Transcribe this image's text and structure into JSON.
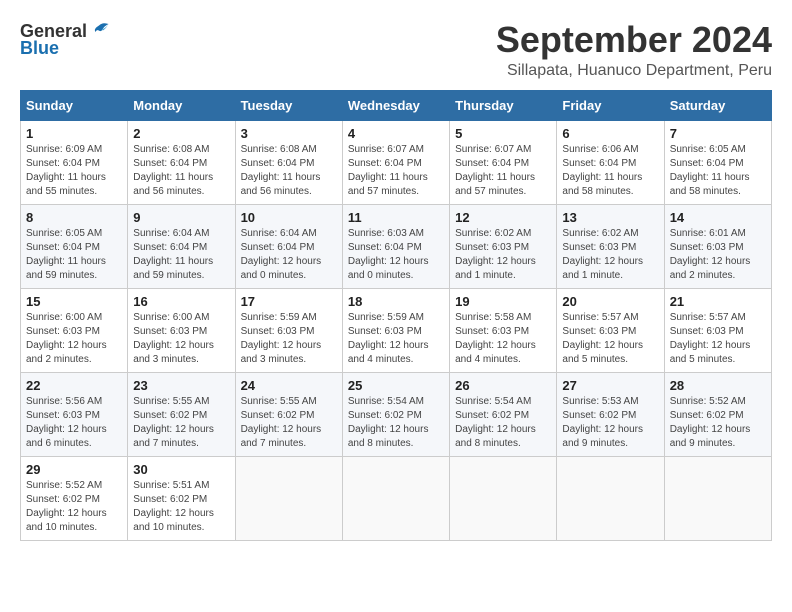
{
  "header": {
    "logo_general": "General",
    "logo_blue": "Blue",
    "month_title": "September 2024",
    "location": "Sillapata, Huanuco Department, Peru"
  },
  "weekdays": [
    "Sunday",
    "Monday",
    "Tuesday",
    "Wednesday",
    "Thursday",
    "Friday",
    "Saturday"
  ],
  "weeks": [
    [
      {
        "day": "1",
        "sunrise": "Sunrise: 6:09 AM",
        "sunset": "Sunset: 6:04 PM",
        "daylight": "Daylight: 11 hours and 55 minutes."
      },
      {
        "day": "2",
        "sunrise": "Sunrise: 6:08 AM",
        "sunset": "Sunset: 6:04 PM",
        "daylight": "Daylight: 11 hours and 56 minutes."
      },
      {
        "day": "3",
        "sunrise": "Sunrise: 6:08 AM",
        "sunset": "Sunset: 6:04 PM",
        "daylight": "Daylight: 11 hours and 56 minutes."
      },
      {
        "day": "4",
        "sunrise": "Sunrise: 6:07 AM",
        "sunset": "Sunset: 6:04 PM",
        "daylight": "Daylight: 11 hours and 57 minutes."
      },
      {
        "day": "5",
        "sunrise": "Sunrise: 6:07 AM",
        "sunset": "Sunset: 6:04 PM",
        "daylight": "Daylight: 11 hours and 57 minutes."
      },
      {
        "day": "6",
        "sunrise": "Sunrise: 6:06 AM",
        "sunset": "Sunset: 6:04 PM",
        "daylight": "Daylight: 11 hours and 58 minutes."
      },
      {
        "day": "7",
        "sunrise": "Sunrise: 6:05 AM",
        "sunset": "Sunset: 6:04 PM",
        "daylight": "Daylight: 11 hours and 58 minutes."
      }
    ],
    [
      {
        "day": "8",
        "sunrise": "Sunrise: 6:05 AM",
        "sunset": "Sunset: 6:04 PM",
        "daylight": "Daylight: 11 hours and 59 minutes."
      },
      {
        "day": "9",
        "sunrise": "Sunrise: 6:04 AM",
        "sunset": "Sunset: 6:04 PM",
        "daylight": "Daylight: 11 hours and 59 minutes."
      },
      {
        "day": "10",
        "sunrise": "Sunrise: 6:04 AM",
        "sunset": "Sunset: 6:04 PM",
        "daylight": "Daylight: 12 hours and 0 minutes."
      },
      {
        "day": "11",
        "sunrise": "Sunrise: 6:03 AM",
        "sunset": "Sunset: 6:04 PM",
        "daylight": "Daylight: 12 hours and 0 minutes."
      },
      {
        "day": "12",
        "sunrise": "Sunrise: 6:02 AM",
        "sunset": "Sunset: 6:03 PM",
        "daylight": "Daylight: 12 hours and 1 minute."
      },
      {
        "day": "13",
        "sunrise": "Sunrise: 6:02 AM",
        "sunset": "Sunset: 6:03 PM",
        "daylight": "Daylight: 12 hours and 1 minute."
      },
      {
        "day": "14",
        "sunrise": "Sunrise: 6:01 AM",
        "sunset": "Sunset: 6:03 PM",
        "daylight": "Daylight: 12 hours and 2 minutes."
      }
    ],
    [
      {
        "day": "15",
        "sunrise": "Sunrise: 6:00 AM",
        "sunset": "Sunset: 6:03 PM",
        "daylight": "Daylight: 12 hours and 2 minutes."
      },
      {
        "day": "16",
        "sunrise": "Sunrise: 6:00 AM",
        "sunset": "Sunset: 6:03 PM",
        "daylight": "Daylight: 12 hours and 3 minutes."
      },
      {
        "day": "17",
        "sunrise": "Sunrise: 5:59 AM",
        "sunset": "Sunset: 6:03 PM",
        "daylight": "Daylight: 12 hours and 3 minutes."
      },
      {
        "day": "18",
        "sunrise": "Sunrise: 5:59 AM",
        "sunset": "Sunset: 6:03 PM",
        "daylight": "Daylight: 12 hours and 4 minutes."
      },
      {
        "day": "19",
        "sunrise": "Sunrise: 5:58 AM",
        "sunset": "Sunset: 6:03 PM",
        "daylight": "Daylight: 12 hours and 4 minutes."
      },
      {
        "day": "20",
        "sunrise": "Sunrise: 5:57 AM",
        "sunset": "Sunset: 6:03 PM",
        "daylight": "Daylight: 12 hours and 5 minutes."
      },
      {
        "day": "21",
        "sunrise": "Sunrise: 5:57 AM",
        "sunset": "Sunset: 6:03 PM",
        "daylight": "Daylight: 12 hours and 5 minutes."
      }
    ],
    [
      {
        "day": "22",
        "sunrise": "Sunrise: 5:56 AM",
        "sunset": "Sunset: 6:03 PM",
        "daylight": "Daylight: 12 hours and 6 minutes."
      },
      {
        "day": "23",
        "sunrise": "Sunrise: 5:55 AM",
        "sunset": "Sunset: 6:02 PM",
        "daylight": "Daylight: 12 hours and 7 minutes."
      },
      {
        "day": "24",
        "sunrise": "Sunrise: 5:55 AM",
        "sunset": "Sunset: 6:02 PM",
        "daylight": "Daylight: 12 hours and 7 minutes."
      },
      {
        "day": "25",
        "sunrise": "Sunrise: 5:54 AM",
        "sunset": "Sunset: 6:02 PM",
        "daylight": "Daylight: 12 hours and 8 minutes."
      },
      {
        "day": "26",
        "sunrise": "Sunrise: 5:54 AM",
        "sunset": "Sunset: 6:02 PM",
        "daylight": "Daylight: 12 hours and 8 minutes."
      },
      {
        "day": "27",
        "sunrise": "Sunrise: 5:53 AM",
        "sunset": "Sunset: 6:02 PM",
        "daylight": "Daylight: 12 hours and 9 minutes."
      },
      {
        "day": "28",
        "sunrise": "Sunrise: 5:52 AM",
        "sunset": "Sunset: 6:02 PM",
        "daylight": "Daylight: 12 hours and 9 minutes."
      }
    ],
    [
      {
        "day": "29",
        "sunrise": "Sunrise: 5:52 AM",
        "sunset": "Sunset: 6:02 PM",
        "daylight": "Daylight: 12 hours and 10 minutes."
      },
      {
        "day": "30",
        "sunrise": "Sunrise: 5:51 AM",
        "sunset": "Sunset: 6:02 PM",
        "daylight": "Daylight: 12 hours and 10 minutes."
      },
      null,
      null,
      null,
      null,
      null
    ]
  ]
}
